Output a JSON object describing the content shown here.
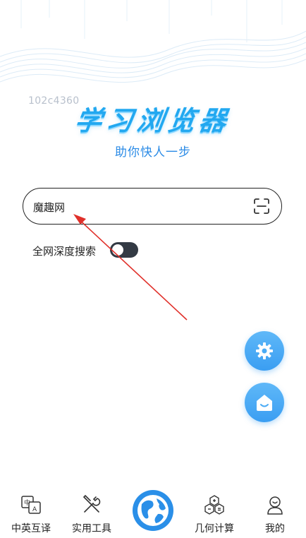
{
  "build_id": "102c4360",
  "app": {
    "title": "学习浏览器",
    "subtitle": "助你快人一步"
  },
  "search": {
    "value": "魔趣网",
    "scan_icon": "scan-icon"
  },
  "deep_search": {
    "label": "全网深度搜索",
    "enabled": false
  },
  "fabs": [
    {
      "icon": "gear-icon"
    },
    {
      "icon": "home-icon"
    }
  ],
  "bottom_nav": {
    "items": [
      {
        "label": "中英互译",
        "icon": "translate-icon"
      },
      {
        "label": "实用工具",
        "icon": "tools-icon"
      },
      {
        "label": "",
        "icon": "globe-icon"
      },
      {
        "label": "几何计算",
        "icon": "geometry-icon"
      },
      {
        "label": "我的",
        "icon": "profile-icon"
      }
    ]
  },
  "colors": {
    "accent": "#22a8f0",
    "subtitle": "#2b8be6",
    "fab": "#3a9ef2",
    "globe": "#2a8fe8",
    "annotation_arrow": "#e0302a"
  }
}
